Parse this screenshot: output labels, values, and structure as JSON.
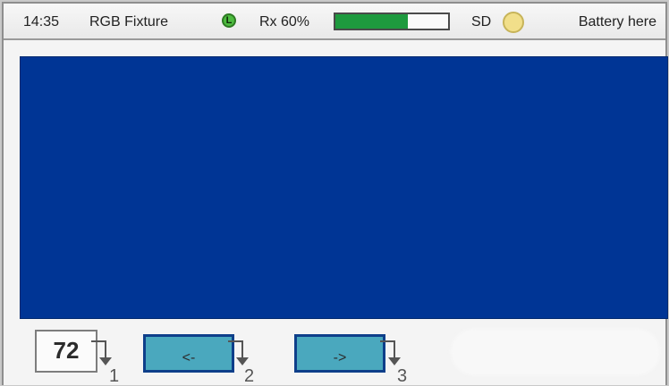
{
  "status_bar": {
    "time": "14:35",
    "title": "RGB Fixture",
    "link_icon": "L",
    "rx_label": "Rx 60%",
    "rx_level": 0.64,
    "sd_label": "SD",
    "battery": "Battery here"
  },
  "preview": {
    "color": "#003595"
  },
  "controls": {
    "value": "72",
    "prev_label": "<-",
    "next_label": "->",
    "key_1": "1",
    "key_2": "2",
    "key_3": "3"
  },
  "icons": {
    "link": "link-status-icon",
    "sd": "sd-card-icon",
    "key": "key-arrow-icon"
  }
}
